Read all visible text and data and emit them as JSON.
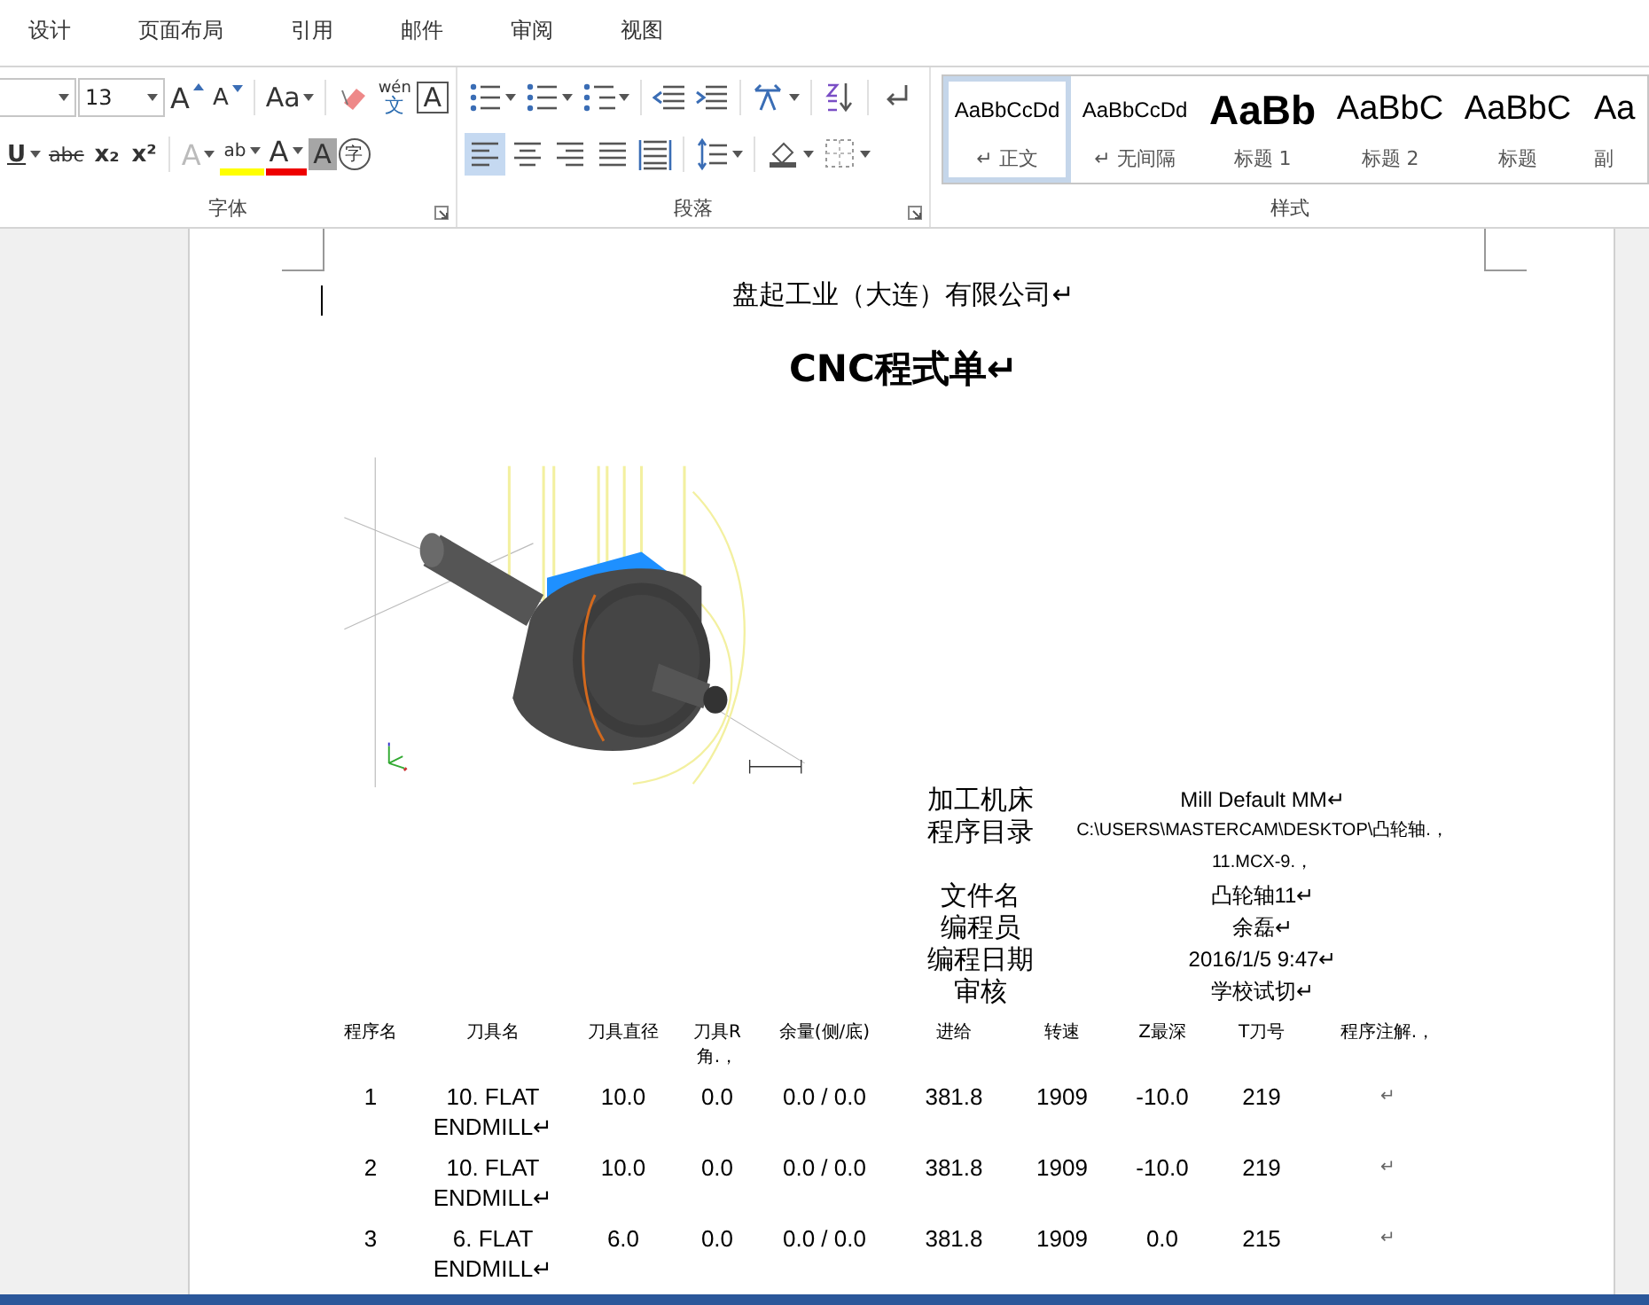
{
  "menu_tabs": [
    {
      "label": "设计",
      "selected": false
    },
    {
      "label": "页面布局",
      "selected": false
    },
    {
      "label": "引用",
      "selected": false
    },
    {
      "label": "邮件",
      "selected": false
    },
    {
      "label": "审阅",
      "selected": false
    },
    {
      "label": "视图",
      "selected": false
    }
  ],
  "font_group": {
    "label": "字体",
    "font_size": "13",
    "row1": [
      {
        "kind": "grow",
        "text": "A"
      },
      {
        "kind": "shrink",
        "text": "A"
      },
      {
        "kind": "case",
        "text": "Aa"
      },
      {
        "kind": "clear"
      },
      {
        "kind": "phonetic",
        "text": "wén",
        "sub": "文"
      },
      {
        "kind": "border",
        "text": "A"
      }
    ],
    "row2": [
      {
        "kind": "underline",
        "text": "U"
      },
      {
        "kind": "strike",
        "text": "abc"
      },
      {
        "kind": "sub",
        "text": "x₂"
      },
      {
        "kind": "sup",
        "text": "x²"
      },
      {
        "kind": "effect",
        "text": "A"
      },
      {
        "kind": "highlight",
        "text": "ab"
      },
      {
        "kind": "color",
        "text": "A"
      },
      {
        "kind": "shade",
        "text": "A"
      },
      {
        "kind": "enclose",
        "text": "字"
      }
    ]
  },
  "paragraph_group": {
    "label": "段落",
    "row1": [
      {
        "kind": "bullets"
      },
      {
        "kind": "numbering"
      },
      {
        "kind": "multilevel"
      },
      {
        "kind": "outdent"
      },
      {
        "kind": "indent"
      },
      {
        "kind": "direction"
      },
      {
        "kind": "sort"
      },
      {
        "kind": "marks"
      }
    ],
    "row2": [
      {
        "kind": "left",
        "selected": true
      },
      {
        "kind": "center",
        "selected": false
      },
      {
        "kind": "right",
        "selected": false
      },
      {
        "kind": "justify",
        "selected": false
      },
      {
        "kind": "distribute",
        "selected": false
      },
      {
        "kind": "spacing",
        "selected": false
      },
      {
        "kind": "fill",
        "selected": false
      },
      {
        "kind": "borders",
        "selected": false
      }
    ]
  },
  "styles_group": {
    "label": "样式",
    "items": [
      {
        "preview": "AaBbCcDd",
        "name": "正文",
        "kind": "small",
        "mark": "↵",
        "selected": true
      },
      {
        "preview": "AaBbCcDd",
        "name": "无间隔",
        "kind": "small",
        "mark": "↵",
        "selected": false
      },
      {
        "preview": "AaBb",
        "name": "标题 1",
        "kind": "heavy",
        "selected": false
      },
      {
        "preview": "AaBbC",
        "name": "标题 2",
        "kind": "large",
        "selected": false
      },
      {
        "preview": "AaBbC",
        "name": "标题",
        "kind": "large",
        "selected": false
      },
      {
        "preview": "Aa",
        "name": "副",
        "kind": "large",
        "selected": false
      }
    ]
  },
  "document": {
    "company": "盘起工业（大连）有限公司↵",
    "title": "CNC程式单↵",
    "info": [
      {
        "label": "加工机床",
        "value": "Mill Default MM↵"
      },
      {
        "label": "程序目录",
        "value": "C:\\USERS\\MASTERCAM\\DESKTOP\\凸轮轴.，",
        "value_2": "11.MCX-9.，"
      },
      {
        "label": "文件名",
        "value": "凸轮轴11↵"
      },
      {
        "label": "编程员",
        "value": "余磊↵"
      },
      {
        "label": "编程日期",
        "value": "2016/1/5 9:47↵"
      },
      {
        "label": "审核",
        "value": "学校试切↵"
      }
    ],
    "table": {
      "columns": [
        "程序名",
        "刀具名",
        "刀具直径",
        "刀具R角.，",
        "余量(侧/底)",
        "进给",
        "转速",
        "Z最深",
        "T刀号",
        "程序注解.，"
      ],
      "rows": [
        [
          "1",
          "10. FLAT ENDMILL↵",
          "10.0",
          "0.0",
          "0.0 / 0.0",
          "381.8",
          "1909",
          "-10.0",
          "219",
          "↵"
        ],
        [
          "2",
          "10. FLAT ENDMILL↵",
          "10.0",
          "0.0",
          "0.0 / 0.0",
          "381.8",
          "1909",
          "-10.0",
          "219",
          "↵"
        ],
        [
          "3",
          "6. FLAT ENDMILL↵",
          "6.0",
          "0.0",
          "0.0 / 0.0",
          "381.8",
          "1909",
          "0.0",
          "215",
          "↵"
        ]
      ]
    }
  }
}
